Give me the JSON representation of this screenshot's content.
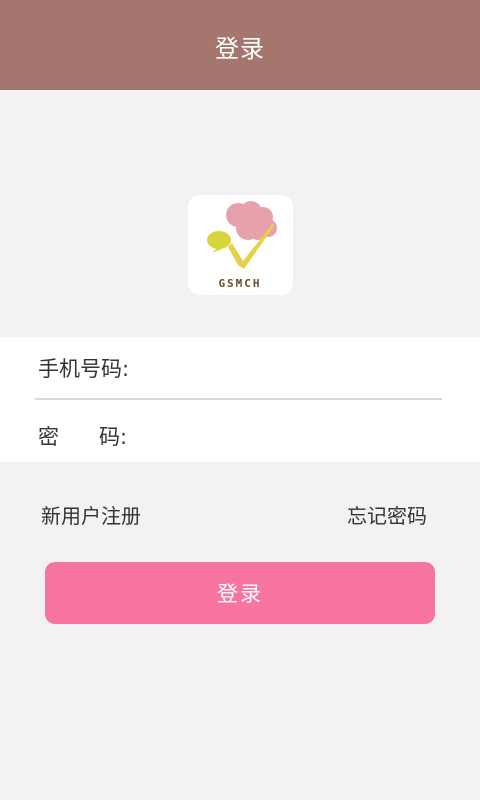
{
  "header": {
    "title": "登录"
  },
  "logo": {
    "text": "GSMCH",
    "icon": "app-logo-icon",
    "colors": {
      "pink": "#e7a1ad",
      "yellow": "#e6d24a",
      "text": "#6a4a2e"
    }
  },
  "form": {
    "phone_label": "手机号码:",
    "phone_value": "",
    "password_label": "密      码:",
    "password_value": ""
  },
  "links": {
    "register": "新用户注册",
    "forgot": "忘记密码"
  },
  "actions": {
    "login": "登录"
  },
  "colors": {
    "header_bg": "#a5766d",
    "page_bg": "#f2f2f2",
    "button_bg": "#f774a1"
  }
}
